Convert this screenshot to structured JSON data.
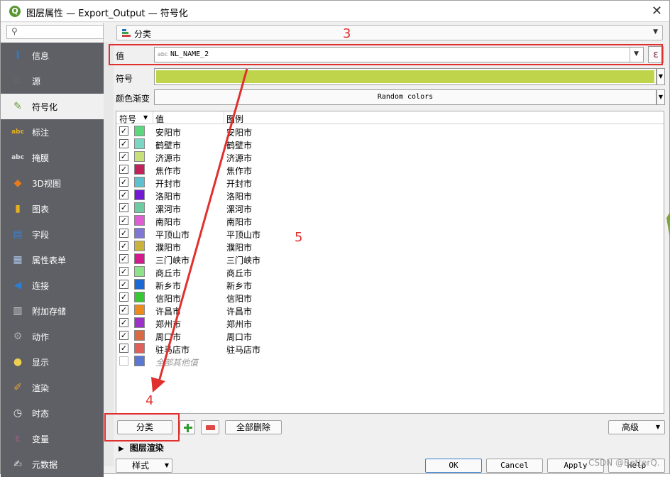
{
  "window": {
    "title": "图层属性 — Export_Output — 符号化",
    "close_glyph": "✕"
  },
  "sidebar": {
    "search_placeholder": "",
    "items": [
      {
        "label": "信息",
        "icon": "info-icon"
      },
      {
        "label": "源",
        "icon": "source-icon"
      },
      {
        "label": "符号化",
        "icon": "symbology-icon",
        "active": true
      },
      {
        "label": "标注",
        "icon": "labels-icon"
      },
      {
        "label": "掩膜",
        "icon": "mask-icon"
      },
      {
        "label": "3D视图",
        "icon": "3d-view-icon"
      },
      {
        "label": "图表",
        "icon": "diagram-icon"
      },
      {
        "label": "字段",
        "icon": "fields-icon"
      },
      {
        "label": "属性表单",
        "icon": "attribute-form-icon"
      },
      {
        "label": "连接",
        "icon": "joins-icon"
      },
      {
        "label": "附加存储",
        "icon": "auxiliary-storage-icon"
      },
      {
        "label": "动作",
        "icon": "actions-icon"
      },
      {
        "label": "显示",
        "icon": "display-icon"
      },
      {
        "label": "渲染",
        "icon": "rendering-icon"
      },
      {
        "label": "时态",
        "icon": "temporal-icon"
      },
      {
        "label": "变量",
        "icon": "variables-icon"
      },
      {
        "label": "元数据",
        "icon": "metadata-icon"
      }
    ]
  },
  "renderer": {
    "type_label": "分类"
  },
  "value_field": {
    "label": "值",
    "type_badge": "abc",
    "value": "NL_NAME_2",
    "expression_glyph": "ε"
  },
  "symbol": {
    "label": "符号",
    "color": "#bfd44a"
  },
  "color_ramp": {
    "label": "颜色渐变",
    "value": "Random colors"
  },
  "table": {
    "headers": {
      "symbol": "符号",
      "value": "值",
      "legend": "图例"
    },
    "rows": [
      {
        "checked": true,
        "color": "#5cd77e",
        "value": "安阳市",
        "legend": "安阳市"
      },
      {
        "checked": true,
        "color": "#7cd6c4",
        "value": "鹤壁市",
        "legend": "鹤壁市"
      },
      {
        "checked": true,
        "color": "#c8e07a",
        "value": "济源市",
        "legend": "济源市"
      },
      {
        "checked": true,
        "color": "#c3215a",
        "value": "焦作市",
        "legend": "焦作市"
      },
      {
        "checked": true,
        "color": "#5ec1cf",
        "value": "开封市",
        "legend": "开封市"
      },
      {
        "checked": true,
        "color": "#7319d6",
        "value": "洛阳市",
        "legend": "洛阳市"
      },
      {
        "checked": true,
        "color": "#6ecca3",
        "value": "漯河市",
        "legend": "漯河市"
      },
      {
        "checked": true,
        "color": "#e05ed3",
        "value": "南阳市",
        "legend": "南阳市"
      },
      {
        "checked": true,
        "color": "#8077d5",
        "value": "平顶山市",
        "legend": "平顶山市"
      },
      {
        "checked": true,
        "color": "#c9b33c",
        "value": "濮阳市",
        "legend": "濮阳市"
      },
      {
        "checked": true,
        "color": "#d4188e",
        "value": "三门峡市",
        "legend": "三门峡市"
      },
      {
        "checked": true,
        "color": "#8ee28a",
        "value": "商丘市",
        "legend": "商丘市"
      },
      {
        "checked": true,
        "color": "#1b69d6",
        "value": "新乡市",
        "legend": "新乡市"
      },
      {
        "checked": true,
        "color": "#36c734",
        "value": "信阳市",
        "legend": "信阳市"
      },
      {
        "checked": true,
        "color": "#ec8a1c",
        "value": "许昌市",
        "legend": "许昌市"
      },
      {
        "checked": true,
        "color": "#9c32c8",
        "value": "郑州市",
        "legend": "郑州市"
      },
      {
        "checked": true,
        "color": "#d86a44",
        "value": "周口市",
        "legend": "周口市"
      },
      {
        "checked": true,
        "color": "#e0605c",
        "value": "驻马店市",
        "legend": "驻马店市"
      },
      {
        "checked": false,
        "color": "#5a78d0",
        "value": "全部其他值",
        "legend": "",
        "italic": true
      }
    ]
  },
  "actions": {
    "classify": "分类",
    "delete_all": "全部删除",
    "advanced": "高级"
  },
  "layer_rendering_label": "图层渲染",
  "footer": {
    "style": "样式",
    "ok": "OK",
    "cancel": "Cancel",
    "apply": "Apply",
    "help": "Help"
  },
  "annotations": {
    "n3": "3",
    "n4": "4",
    "n5": "5",
    "color": "#e0302d"
  },
  "watermark": "CSDN @BetterQ."
}
